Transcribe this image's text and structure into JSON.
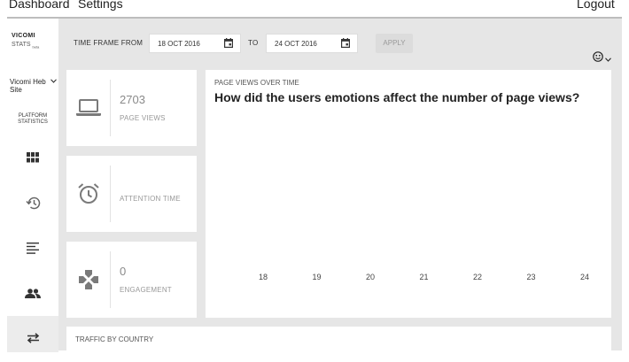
{
  "topnav": {
    "dashboard": "Dashboard",
    "settings": "Settings",
    "logout": "Logout"
  },
  "sidebar": {
    "brand_line1": "VICOMI",
    "brand_line2": "STATS",
    "brand_sub": "beta",
    "site_name": "Vicomi Heb Site",
    "platform_line1": "PLATFORM",
    "platform_line2": "STATISTICS",
    "nav_icons": [
      "grid-icon",
      "history-icon",
      "text-lines-icon",
      "people-icon",
      "swap-arrows-icon"
    ]
  },
  "filters": {
    "from_label": "TIME FRAME FROM",
    "from_date": "18 OCT 2016",
    "to_label": "TO",
    "to_date": "24 OCT 2016",
    "apply_label": "APPLY",
    "emotion_filter_icon": "smiley-icon"
  },
  "stats": {
    "page_views": {
      "value": "2703",
      "label": "PAGE VIEWS",
      "icon": "laptop-icon"
    },
    "attention": {
      "value": "",
      "label": "ATTENTION TIME",
      "icon": "alarm-clock-icon"
    },
    "engagement": {
      "value": "0",
      "label": "ENGAGEMENT",
      "icon": "gamepad-icon"
    }
  },
  "chart": {
    "subtitle": "PAGE VIEWS OVER TIME",
    "title": "How did the users emotions affect the number of page views?"
  },
  "chart_data": {
    "type": "line",
    "title": "How did the users emotions affect the number of page views?",
    "subtitle": "PAGE VIEWS OVER TIME",
    "x": [
      18,
      19,
      20,
      21,
      22,
      23,
      24
    ],
    "series": []
  },
  "traffic": {
    "title": "TRAFFIC BY COUNTRY"
  },
  "colors": {
    "background": "#e6e6e6",
    "card": "#ffffff",
    "icon": "#7a7a7a",
    "nav_icon": "#444444"
  }
}
